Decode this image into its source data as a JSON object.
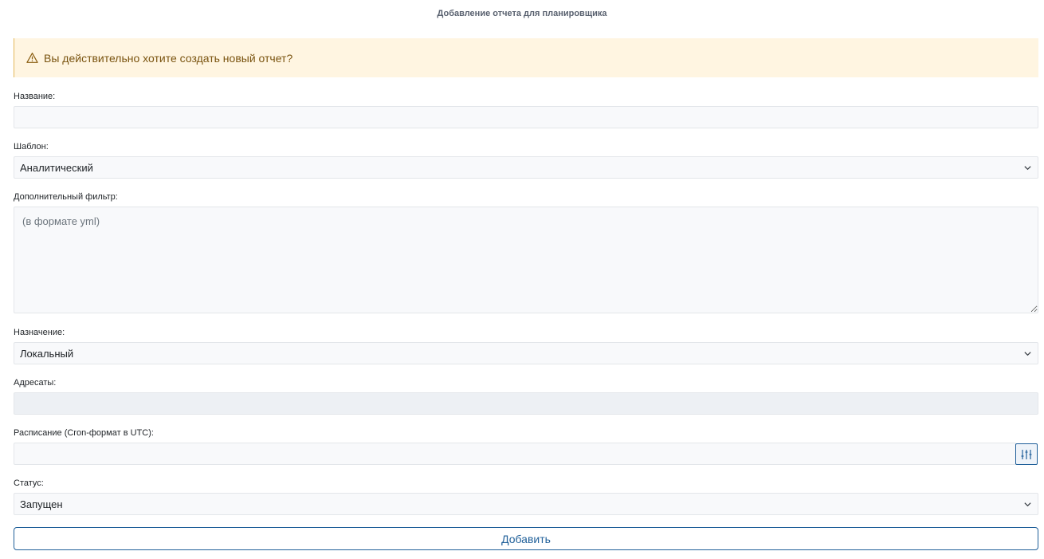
{
  "page": {
    "title": "Добавление отчета для планировщика"
  },
  "alert": {
    "text": "Вы действительно хотите создать новый отчет?",
    "icon": "warning-triangle-icon",
    "color": "#7a5410",
    "background": "#fff5e1"
  },
  "form": {
    "name": {
      "label": "Название:",
      "value": ""
    },
    "template": {
      "label": "Шаблон:",
      "selected": "Аналитический"
    },
    "filter": {
      "label": "Дополнительный фильтр:",
      "placeholder": "(в формате yml)",
      "value": ""
    },
    "destination": {
      "label": "Назначение:",
      "selected": "Локальный"
    },
    "recipients": {
      "label": "Адресаты:",
      "value": ""
    },
    "schedule": {
      "label": "Расписание (Cron-формат в UTC):",
      "value": "",
      "button_icon": "sliders-icon"
    },
    "status": {
      "label": "Статус:",
      "selected": "Запущен"
    },
    "submit_label": "Добавить"
  },
  "colors": {
    "accent": "#1f5f99",
    "field_bg": "#f8f9fb",
    "field_border": "#e3e6ea"
  }
}
